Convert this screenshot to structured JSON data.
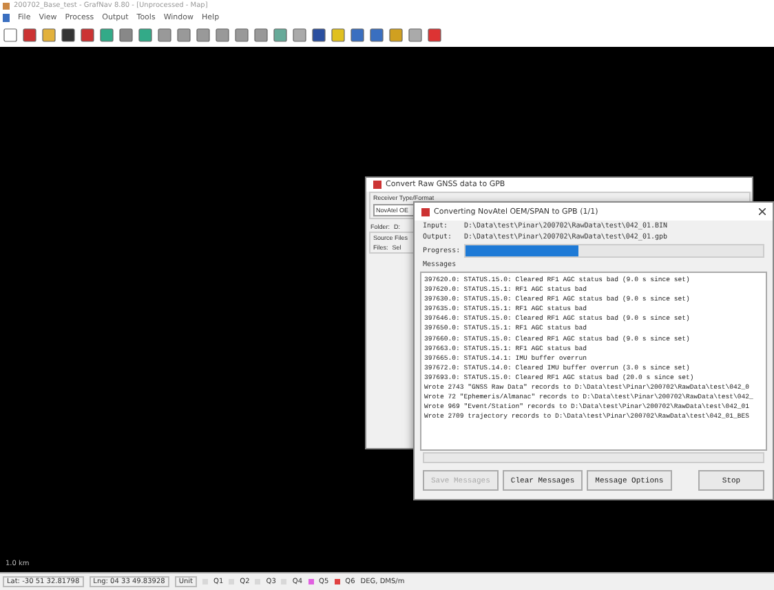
{
  "window": {
    "title": "200702_Base_test - GrafNav 8.80 - [Unprocessed - Map]"
  },
  "menu": [
    "File",
    "View",
    "Process",
    "Output",
    "Tools",
    "Window",
    "Help"
  ],
  "map": {
    "scale": "1.0 km"
  },
  "convert_dialog": {
    "title": "Convert Raw GNSS data to GPB",
    "receiver_group": "Receiver Type/Format",
    "receiver": "NovAtel OE",
    "folder_label": "Folder:",
    "folder": "D:",
    "source_group": "Source Files",
    "files_label": "Files:",
    "files_tab": "Sel"
  },
  "progress_dialog": {
    "title": "Converting NovAtel OEM/SPAN to GPB (1/1)",
    "input_label": "Input:",
    "input": "D:\\Data\\test\\Pinar\\200702\\RawData\\test\\042_01.BIN",
    "output_label": "Output:",
    "output": "D:\\Data\\test\\Pinar\\200702\\RawData\\test\\042_01.gpb",
    "progress_label": "Progress:",
    "level": 0.38,
    "messages_label": "Messages",
    "messages": [
      "397620.0: STATUS.15.0: Cleared RF1 AGC status bad (9.0 s since set)",
      "397620.0: STATUS.15.1: RF1 AGC status bad",
      "397630.0: STATUS.15.0: Cleared RF1 AGC status bad (9.0 s since set)",
      "397635.0: STATUS.15.1: RF1 AGC status bad",
      "397646.0: STATUS.15.0: Cleared RF1 AGC status bad (9.0 s since set)",
      "397650.0: STATUS.15.1: RF1 AGC status bad",
      "397660.0: STATUS.15.0: Cleared RF1 AGC status bad (9.0 s since set)",
      "397663.0: STATUS.15.1: RF1 AGC status bad",
      "397665.0: STATUS.14.1: IMU buffer overrun",
      "397672.0: STATUS.14.0: Cleared IMU buffer overrun (3.0 s since set)",
      "397693.0: STATUS.15.0: Cleared RF1 AGC status bad (20.0 s since set)",
      "Wrote 2743 \"GNSS Raw Data\" records to D:\\Data\\test\\Pinar\\200702\\RawData\\test\\042_0",
      "Wrote 72 \"Ephemeris/Almanac\" records to D:\\Data\\test\\Pinar\\200702\\RawData\\test\\042_",
      "Wrote 969 \"Event/Station\" records to D:\\Data\\test\\Pinar\\200702\\RawData\\test\\042_01",
      "Wrote 2709 trajectory records to D:\\Data\\test\\Pinar\\200702\\RawData\\test\\042_01_BES"
    ],
    "buttons": [
      {
        "label": "Save Messages",
        "disabled": true
      },
      {
        "label": "Clear Messages",
        "disabled": false
      },
      {
        "label": "Message Options",
        "disabled": false
      },
      {
        "label": "Stop",
        "disabled": false
      }
    ]
  },
  "status_bar": {
    "lat": "Lat: -30 51 32.81798",
    "lng": "Lng: 04 33 49.83928",
    "unit": "Unit",
    "quality": [
      {
        "label": "Q1",
        "color": "#d8d8d8"
      },
      {
        "label": "Q2",
        "color": "#d8d8d8"
      },
      {
        "label": "Q3",
        "color": "#d8d8d8"
      },
      {
        "label": "Q4",
        "color": "#d8d8d8"
      },
      {
        "label": "Q5",
        "color": "#e060e0"
      },
      {
        "label": "Q6",
        "color": "#e04040"
      }
    ],
    "format": "DEG, DMS/m"
  }
}
